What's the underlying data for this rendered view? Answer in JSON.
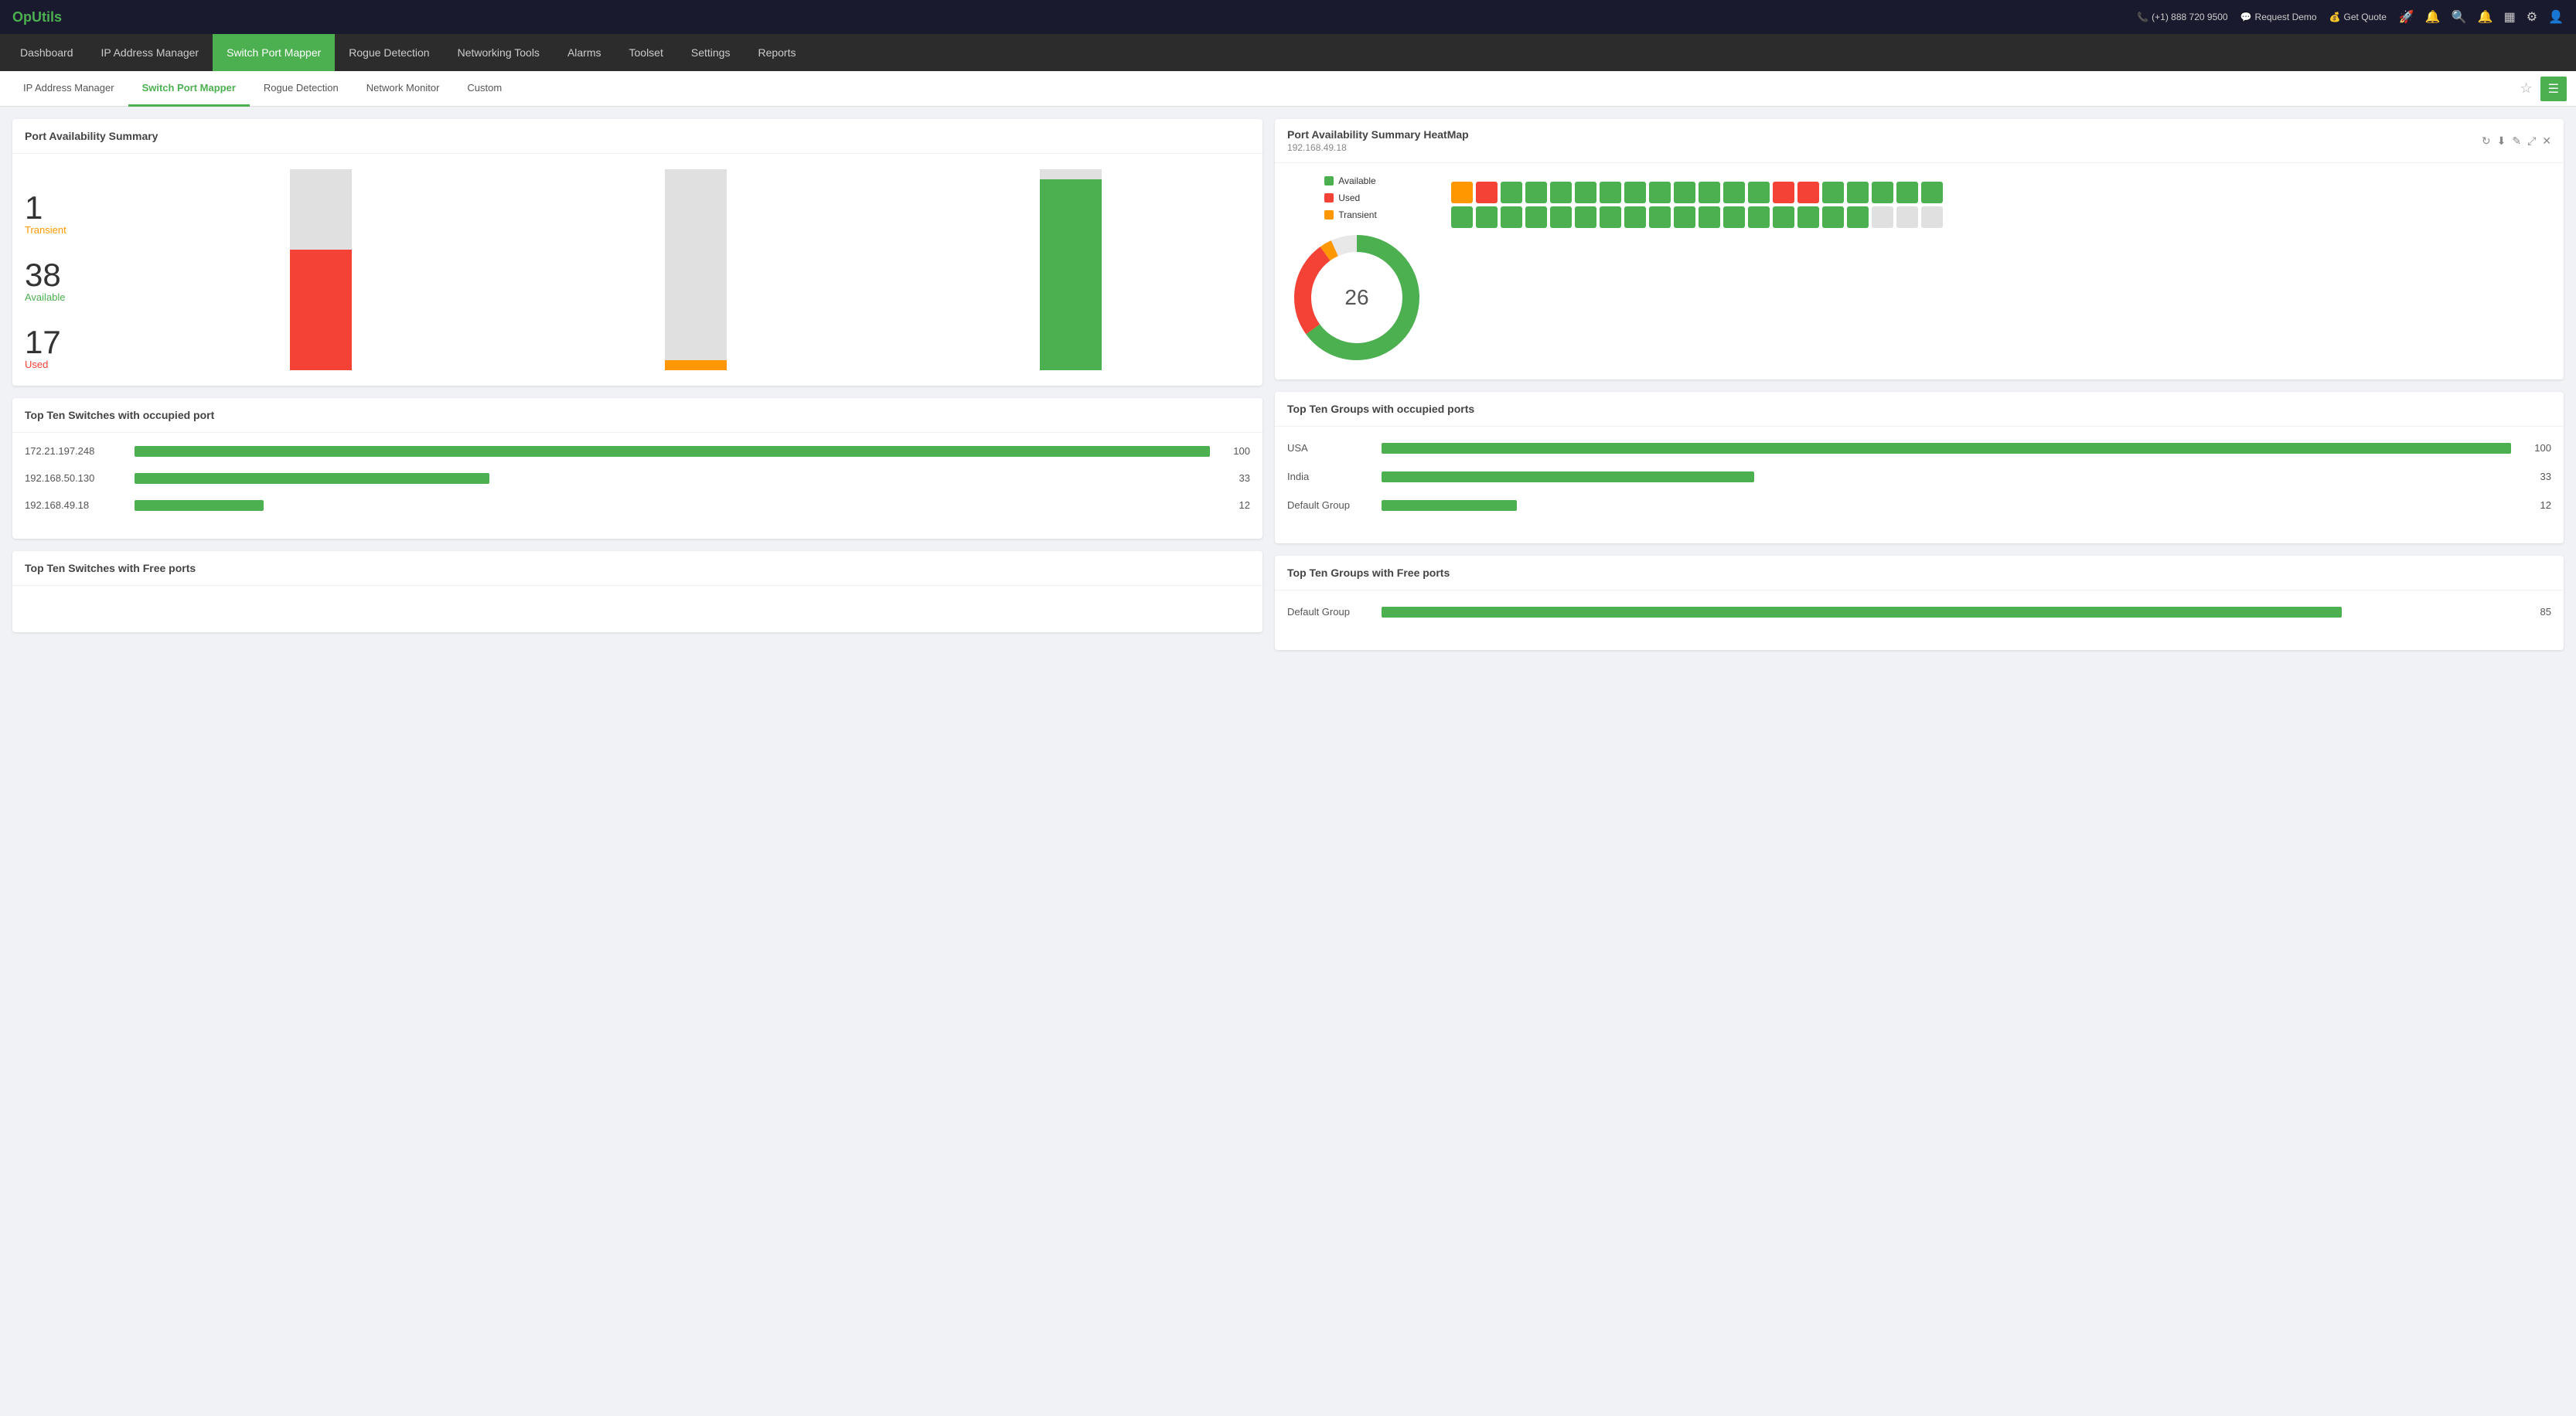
{
  "topbar": {
    "logo": "OpUtils",
    "phone": "(+1) 888 720 9500",
    "request_demo": "Request Demo",
    "get_quote": "Get Quote"
  },
  "navbar": {
    "items": [
      {
        "id": "dashboard",
        "label": "Dashboard",
        "active": false
      },
      {
        "id": "ip-address-manager",
        "label": "IP Address Manager",
        "active": false
      },
      {
        "id": "switch-port-mapper",
        "label": "Switch Port Mapper",
        "active": true
      },
      {
        "id": "rogue-detection",
        "label": "Rogue Detection",
        "active": false
      },
      {
        "id": "networking-tools",
        "label": "Networking Tools",
        "active": false
      },
      {
        "id": "alarms",
        "label": "Alarms",
        "active": false
      },
      {
        "id": "toolset",
        "label": "Toolset",
        "active": false
      },
      {
        "id": "settings",
        "label": "Settings",
        "active": false
      },
      {
        "id": "reports",
        "label": "Reports",
        "active": false
      }
    ]
  },
  "subnav": {
    "items": [
      {
        "id": "ip-address-manager",
        "label": "IP Address Manager",
        "active": false
      },
      {
        "id": "switch-port-mapper",
        "label": "Switch Port Mapper",
        "active": true
      },
      {
        "id": "rogue-detection",
        "label": "Rogue Detection",
        "active": false
      },
      {
        "id": "network-monitor",
        "label": "Network Monitor",
        "active": false
      },
      {
        "id": "custom",
        "label": "Custom",
        "active": false
      }
    ]
  },
  "port_availability_summary": {
    "title": "Port Availability Summary",
    "transient_count": "1",
    "transient_label": "Transient",
    "available_count": "38",
    "available_label": "Available",
    "used_count": "17",
    "used_label": "Used"
  },
  "heatmap_card": {
    "title": "Port Availability Summary HeatMap",
    "subtitle": "192.168.49.18",
    "center_value": "26",
    "legend": [
      {
        "id": "available",
        "label": "Available",
        "color": "#4caf50"
      },
      {
        "id": "used",
        "label": "Used",
        "color": "#f44336"
      },
      {
        "id": "transient",
        "label": "Transient",
        "color": "#ff9800"
      }
    ],
    "heatmap_cells": [
      "orange",
      "red",
      "green",
      "green",
      "green",
      "green",
      "green",
      "green",
      "green",
      "green",
      "green",
      "green",
      "green",
      "red",
      "red",
      "green",
      "green",
      "green",
      "green",
      "green",
      "green",
      "green",
      "green",
      "green",
      "green",
      "green",
      "green",
      "green",
      "green",
      "green",
      "green",
      "green",
      "green",
      "green",
      "green",
      "green",
      "green",
      "gray",
      "gray",
      "gray"
    ]
  },
  "top_switches_occupied": {
    "title": "Top Ten Switches with occupied port",
    "items": [
      {
        "label": "172.21.197.248",
        "value": 100,
        "max": 100
      },
      {
        "label": "192.168.50.130",
        "value": 33,
        "max": 100
      },
      {
        "label": "192.168.49.18",
        "value": 12,
        "max": 100
      }
    ]
  },
  "top_groups_occupied": {
    "title": "Top Ten Groups with occupied ports",
    "items": [
      {
        "label": "USA",
        "value": 100,
        "max": 100
      },
      {
        "label": "India",
        "value": 33,
        "max": 100
      },
      {
        "label": "Default Group",
        "value": 12,
        "max": 100
      }
    ]
  },
  "top_switches_free": {
    "title": "Top Ten Switches with Free ports"
  },
  "top_groups_free": {
    "title": "Top Ten Groups with Free ports",
    "items": [
      {
        "label": "Default Group",
        "value": 85,
        "max": 100
      }
    ]
  }
}
